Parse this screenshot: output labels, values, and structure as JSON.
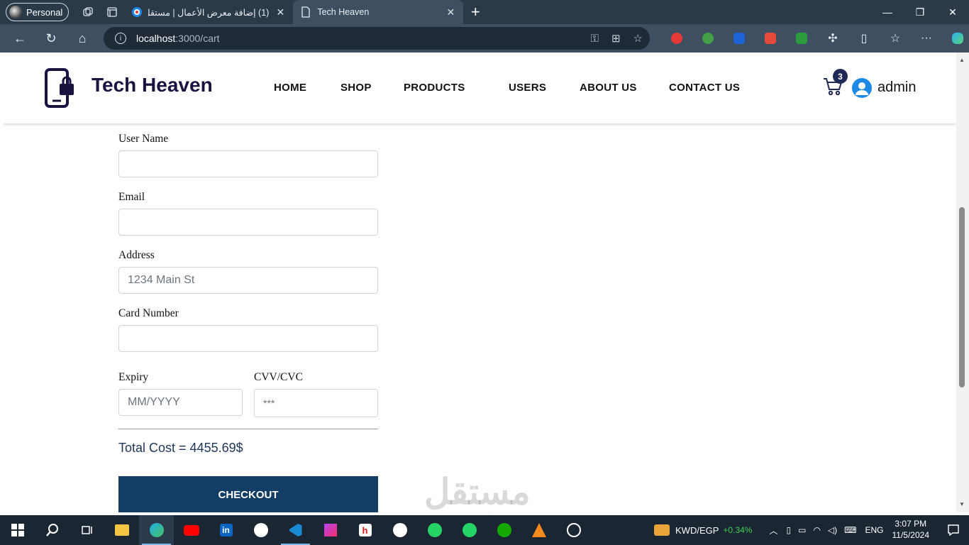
{
  "browser": {
    "profile_label": "Personal",
    "tabs": [
      {
        "title": "(1) إضافة معرض الأعمال | مستقل",
        "active": false
      },
      {
        "title": "Tech Heaven",
        "active": true
      }
    ],
    "url_host": "localhost",
    "url_path": ":3000/cart"
  },
  "site": {
    "brand": "Tech Heaven",
    "nav": [
      "HOME",
      "SHOP",
      "PRODUCTS",
      "USERS",
      "ABOUT US",
      "CONTACT US"
    ],
    "cart_count": "3",
    "username": "admin"
  },
  "form": {
    "user_name_label": "User Name",
    "email_label": "Email",
    "address_label": "Address",
    "address_placeholder": "1234 Main St",
    "card_label": "Card Number",
    "expiry_label": "Expiry",
    "expiry_placeholder": "MM/YYYY",
    "cvv_label": "CVV/CVC",
    "cvv_placeholder": "***",
    "total_text": "Total Cost = 4455.69$",
    "checkout_label": "CHECKOUT"
  },
  "watermark": {
    "arabic": "مستقل",
    "latin": "mostaql.com"
  },
  "taskbar": {
    "ticker_symbol": "KWD/EGP",
    "ticker_change": "+0.34%",
    "lang": "ENG",
    "time": "3:07 PM",
    "date": "11/5/2024"
  },
  "colors": {
    "brand": "#1a1340",
    "button": "#143d66",
    "total": "#1d3557",
    "badge": "#1e2a55"
  }
}
